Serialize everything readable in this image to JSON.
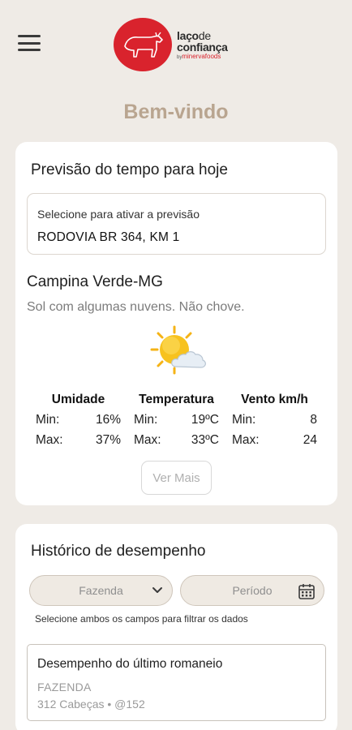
{
  "header": {
    "menu_icon": "hamburger-menu-icon",
    "logo": {
      "line1_bold": "laço",
      "line1_thin": "de",
      "line2": "confiança",
      "line3_prefix": "by",
      "line3": "minervafoods",
      "brand_color": "#d9232d"
    }
  },
  "welcome": "Bem-vindo",
  "weather": {
    "title": "Previsão do tempo para hoje",
    "location_label": "Selecione para ativar a previsão",
    "location_value": "RODOVIA BR 364, KM 1",
    "city": "Campina Verde-MG",
    "condition": "Sol com algumas nuvens. Não chove.",
    "icon": "sun-cloud-icon",
    "stats": [
      {
        "header": "Umidade",
        "min_label": "Min:",
        "min": "16%",
        "max_label": "Max:",
        "max": "37%"
      },
      {
        "header": "Temperatura",
        "min_label": "Min:",
        "min": "19ºC",
        "max_label": "Max:",
        "max": "33ºC"
      },
      {
        "header": "Vento km/h",
        "min_label": "Min:",
        "min": "8",
        "max_label": "Max:",
        "max": "24"
      }
    ],
    "more_button": "Ver Mais"
  },
  "history": {
    "title": "Histórico de desempenho",
    "farm_placeholder": "Fazenda",
    "period_placeholder": "Período",
    "hint": "Selecione ambos os campos para filtrar os dados",
    "last": {
      "title": "Desempenho do último romaneio",
      "farm": "FAZENDA",
      "info": "312 Cabeças • @152"
    }
  }
}
